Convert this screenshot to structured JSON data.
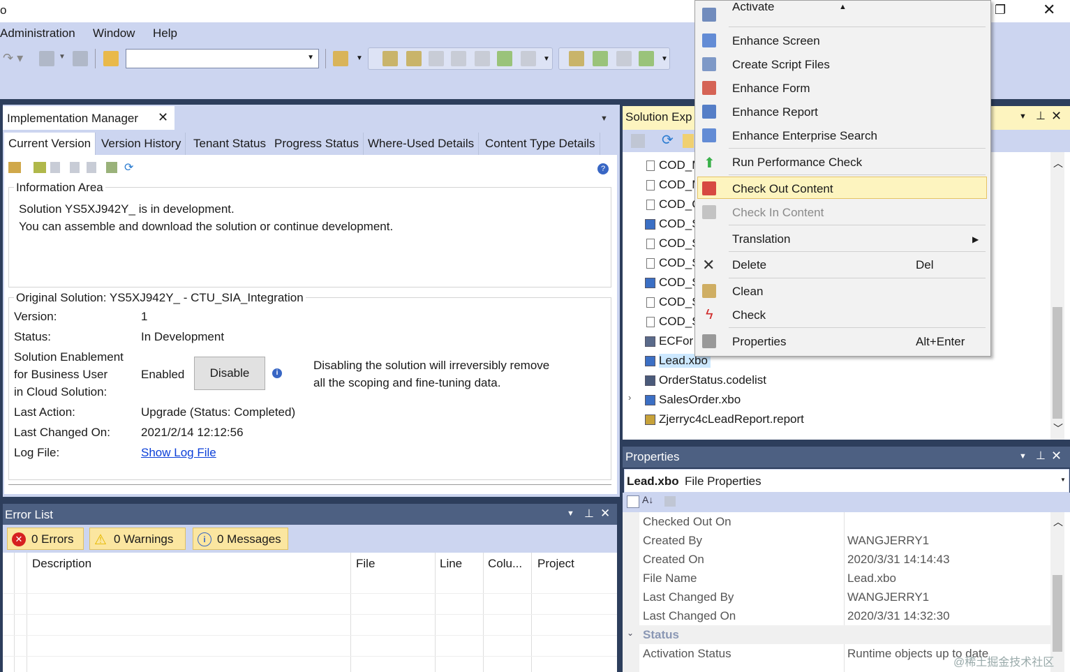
{
  "titlebar": {
    "app_letter": "o"
  },
  "menu": [
    "Administration",
    "Window",
    "Help"
  ],
  "implementation_manager": {
    "title": "Implementation Manager",
    "tabs": [
      "Current Version",
      "Version History",
      "Tenant Status",
      "Progress Status",
      "Where-Used Details",
      "Content Type Details"
    ],
    "info_area_label": "Information Area",
    "info_line1": "Solution YS5XJ942Y_ is in development.",
    "info_line2": "You can assemble and download the solution or continue development.",
    "original_solution_label": "Original Solution: YS5XJ942Y_ - CTU_SIA_Integration",
    "fields": {
      "version_label": "Version:",
      "version_value": "1",
      "status_label": "Status:",
      "status_value": "In Development",
      "enablement_label_1": "Solution Enablement",
      "enablement_label_2": "for Business User",
      "enablement_label_3": "in Cloud Solution:",
      "enablement_value": "Enabled",
      "disable_button": "Disable",
      "disable_note_1": "Disabling the solution will irreversibly remove",
      "disable_note_2": "all the scoping and fine-tuning data.",
      "last_action_label": "Last Action:",
      "last_action_value": "Upgrade (Status: Completed)",
      "last_changed_label": "Last Changed On:",
      "last_changed_value": "2021/2/14 12:12:56",
      "log_file_label": "Log File:",
      "log_file_link": "Show Log File"
    }
  },
  "error_list": {
    "title": "Error List",
    "errors": "0 Errors",
    "warnings": "0 Warnings",
    "messages": "0 Messages",
    "columns": [
      "Description",
      "File",
      "Line",
      "Colu...",
      "Project"
    ]
  },
  "solution_explorer": {
    "title": "Solution Exp",
    "items": [
      {
        "label": "COD_M",
        "icon": "page"
      },
      {
        "label": "COD_M",
        "icon": "page"
      },
      {
        "label": "COD_C",
        "icon": "page"
      },
      {
        "label": "COD_S",
        "icon": "xbo"
      },
      {
        "label": "COD_S",
        "icon": "page"
      },
      {
        "label": "COD_S",
        "icon": "page"
      },
      {
        "label": "COD_S",
        "icon": "xbo"
      },
      {
        "label": "COD_S",
        "icon": "page"
      },
      {
        "label": "COD_S",
        "icon": "page"
      },
      {
        "label": "ECFor",
        "icon": "form"
      },
      {
        "label": "Lead.xbo",
        "icon": "xbo"
      },
      {
        "label": "OrderStatus.codelist",
        "icon": "codelist"
      },
      {
        "label": "SalesOrder.xbo",
        "icon": "xbo"
      },
      {
        "label": "Zjerryc4cLeadReport.report",
        "icon": "report"
      }
    ]
  },
  "context_menu": {
    "items": [
      {
        "label": "Activate",
        "shortcut": ""
      },
      {
        "label": "Enhance Screen",
        "shortcut": ""
      },
      {
        "label": "Create Script Files",
        "shortcut": ""
      },
      {
        "label": "Enhance Form",
        "shortcut": ""
      },
      {
        "label": "Enhance Report",
        "shortcut": ""
      },
      {
        "label": "Enhance Enterprise Search",
        "shortcut": ""
      },
      {
        "label": "Run Performance Check",
        "shortcut": ""
      },
      {
        "label": "Check Out Content",
        "shortcut": ""
      },
      {
        "label": "Check In Content",
        "shortcut": ""
      },
      {
        "label": "Translation",
        "shortcut": ""
      },
      {
        "label": "Delete",
        "shortcut": "Del"
      },
      {
        "label": "Clean",
        "shortcut": ""
      },
      {
        "label": "Check",
        "shortcut": ""
      },
      {
        "label": "Properties",
        "shortcut": "Alt+Enter"
      }
    ]
  },
  "properties": {
    "title": "Properties",
    "header_bold": "Lead.xbo",
    "header_rest": "File Properties",
    "rows": [
      {
        "name": "Checked Out On",
        "value": ""
      },
      {
        "name": "Created By",
        "value": "WANGJERRY1"
      },
      {
        "name": "Created On",
        "value": "2020/3/31 14:14:43"
      },
      {
        "name": "File Name",
        "value": "Lead.xbo"
      },
      {
        "name": "Last Changed By",
        "value": "WANGJERRY1"
      },
      {
        "name": "Last Changed On",
        "value": "2020/3/31 14:32:30"
      }
    ],
    "section": "Status",
    "section_rows": [
      {
        "name": "Activation Status",
        "value": "Runtime objects up to date"
      }
    ],
    "watermark": "@稀土掘金技术社区"
  },
  "colors": {
    "frame": "#2d3e5c",
    "panel_title": "#4d6082",
    "highlight": "#fdf4bf",
    "highlight_border": "#e5c365",
    "link": "#0b3fd8"
  }
}
